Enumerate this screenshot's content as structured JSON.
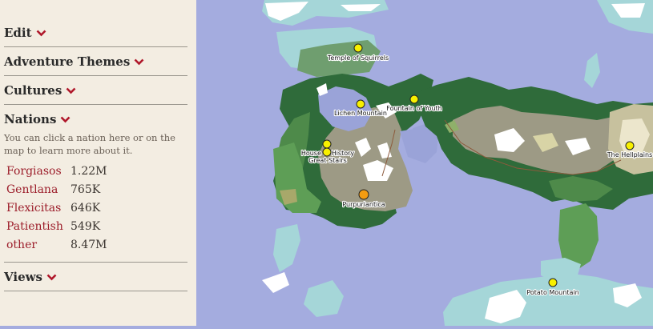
{
  "sidebar": {
    "sections": {
      "edit": "Edit",
      "adventure_themes": "Adventure Themes",
      "cultures": "Cultures",
      "nations": "Nations",
      "views": "Views"
    },
    "nations_help": "You can click a nation here or on the map to learn more about it.",
    "nations": [
      {
        "name": "Forgiasos",
        "population": "1.22M"
      },
      {
        "name": "Gentlana",
        "population": "765K"
      },
      {
        "name": "Flexicitas",
        "population": "646K"
      },
      {
        "name": "Patientish",
        "population": "549K"
      },
      {
        "name": "other",
        "population": "8.47M"
      }
    ],
    "chevron_icon": "chevron-down-icon",
    "colors": {
      "accent": "#b0182b",
      "background": "#f3ede2"
    }
  },
  "map": {
    "colors": {
      "ocean": "#a4acdf",
      "forest": "#2f6b3a",
      "mountain": "#9d9a85",
      "marker": "#f8f000",
      "marker_selected": "#f39c12"
    },
    "markers": {
      "temple": "Temple of Squirrels",
      "lichen": "Lichen Mountain",
      "fountain": "Fountain of Youth",
      "house": "House of History",
      "stairs": "Great Stairs",
      "purpuriantica": "Purpuriantica",
      "hellplains": "The Hellplains",
      "potato": "Potato Mountain"
    }
  }
}
